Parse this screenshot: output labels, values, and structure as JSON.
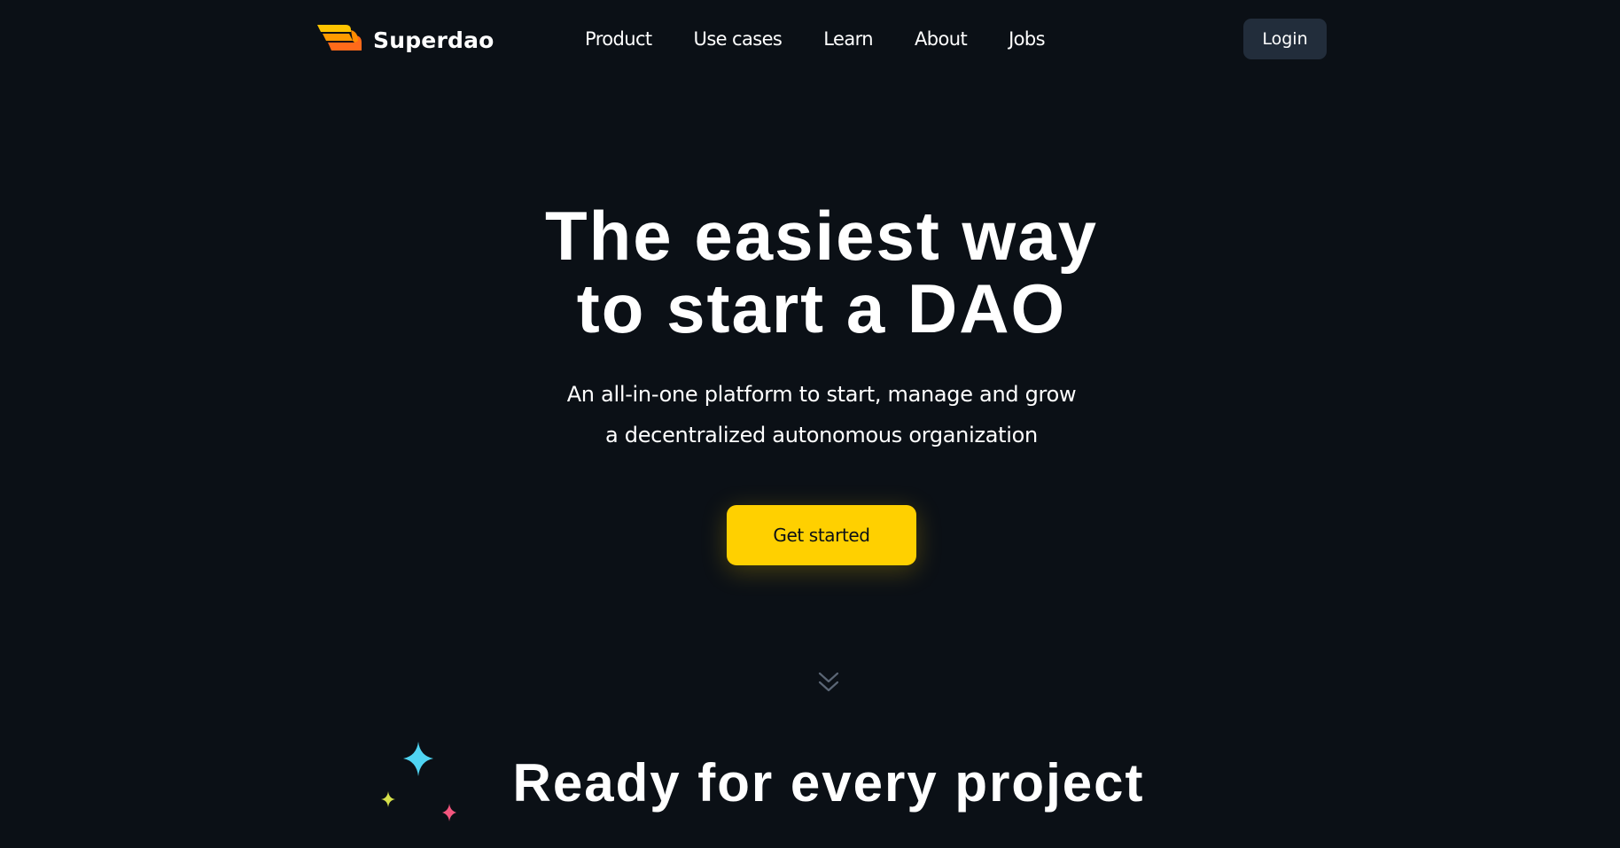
{
  "brand": {
    "name": "Superdao",
    "logo_icon": "superdao-wing-logo-icon",
    "logo_colors": [
      "#ffc400",
      "#ff7a00",
      "#ff4d1a"
    ]
  },
  "nav": {
    "items": [
      {
        "label": "Product"
      },
      {
        "label": "Use cases"
      },
      {
        "label": "Learn"
      },
      {
        "label": "About"
      },
      {
        "label": "Jobs"
      }
    ],
    "login_label": "Login"
  },
  "hero": {
    "title_line1": "The easiest way",
    "title_line2": "to start a DAO",
    "subtitle_line1": "An all-in-one platform to start, manage and grow",
    "subtitle_line2": "a decentralized autonomous organization",
    "cta_label": "Get started",
    "scroll_icon": "chevrons-down-icon"
  },
  "section": {
    "title": "Ready for every project",
    "sparkle_icon": "sparkles-icon"
  },
  "colors": {
    "background": "#0b1016",
    "accent": "#ffd000",
    "login_bg": "#222d3b",
    "sparkle_blue": "#4fd4f2",
    "sparkle_yellow": "#d6e04a",
    "sparkle_pink": "#f4567e"
  }
}
